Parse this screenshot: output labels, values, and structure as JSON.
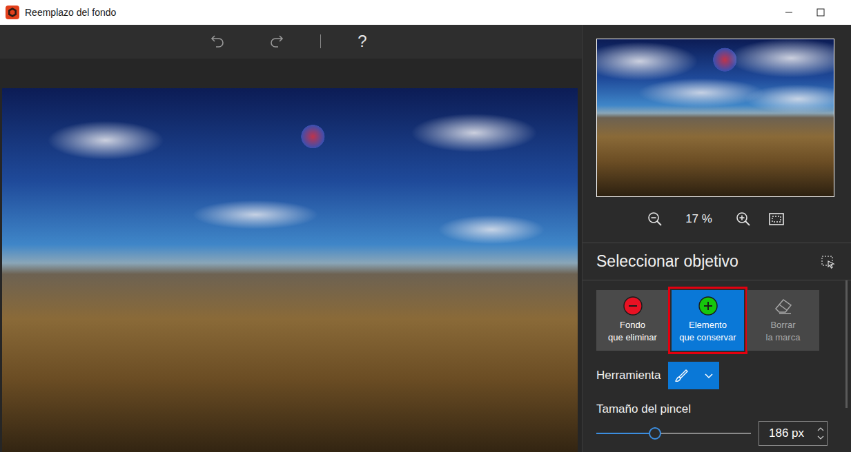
{
  "window": {
    "title": "Reemplazo del fondo"
  },
  "toolbar": {
    "help": "?"
  },
  "navigator": {
    "zoom": "17 %"
  },
  "panel": {
    "title": "Seleccionar objetivo"
  },
  "modes": [
    {
      "kind": "remove",
      "lines": [
        "Fondo",
        "que eliminar"
      ],
      "selected": false,
      "disabled": false,
      "highlighted": false
    },
    {
      "kind": "keep",
      "lines": [
        "Elemento",
        "que conservar"
      ],
      "selected": true,
      "disabled": false,
      "highlighted": true
    },
    {
      "kind": "erase",
      "lines": [
        "Borrar",
        "la marca"
      ],
      "selected": false,
      "disabled": true,
      "highlighted": false
    }
  ],
  "tool": {
    "label": "Herramienta"
  },
  "brush": {
    "label": "Tamaño del pincel",
    "level": 0.38,
    "value": "186 px"
  }
}
